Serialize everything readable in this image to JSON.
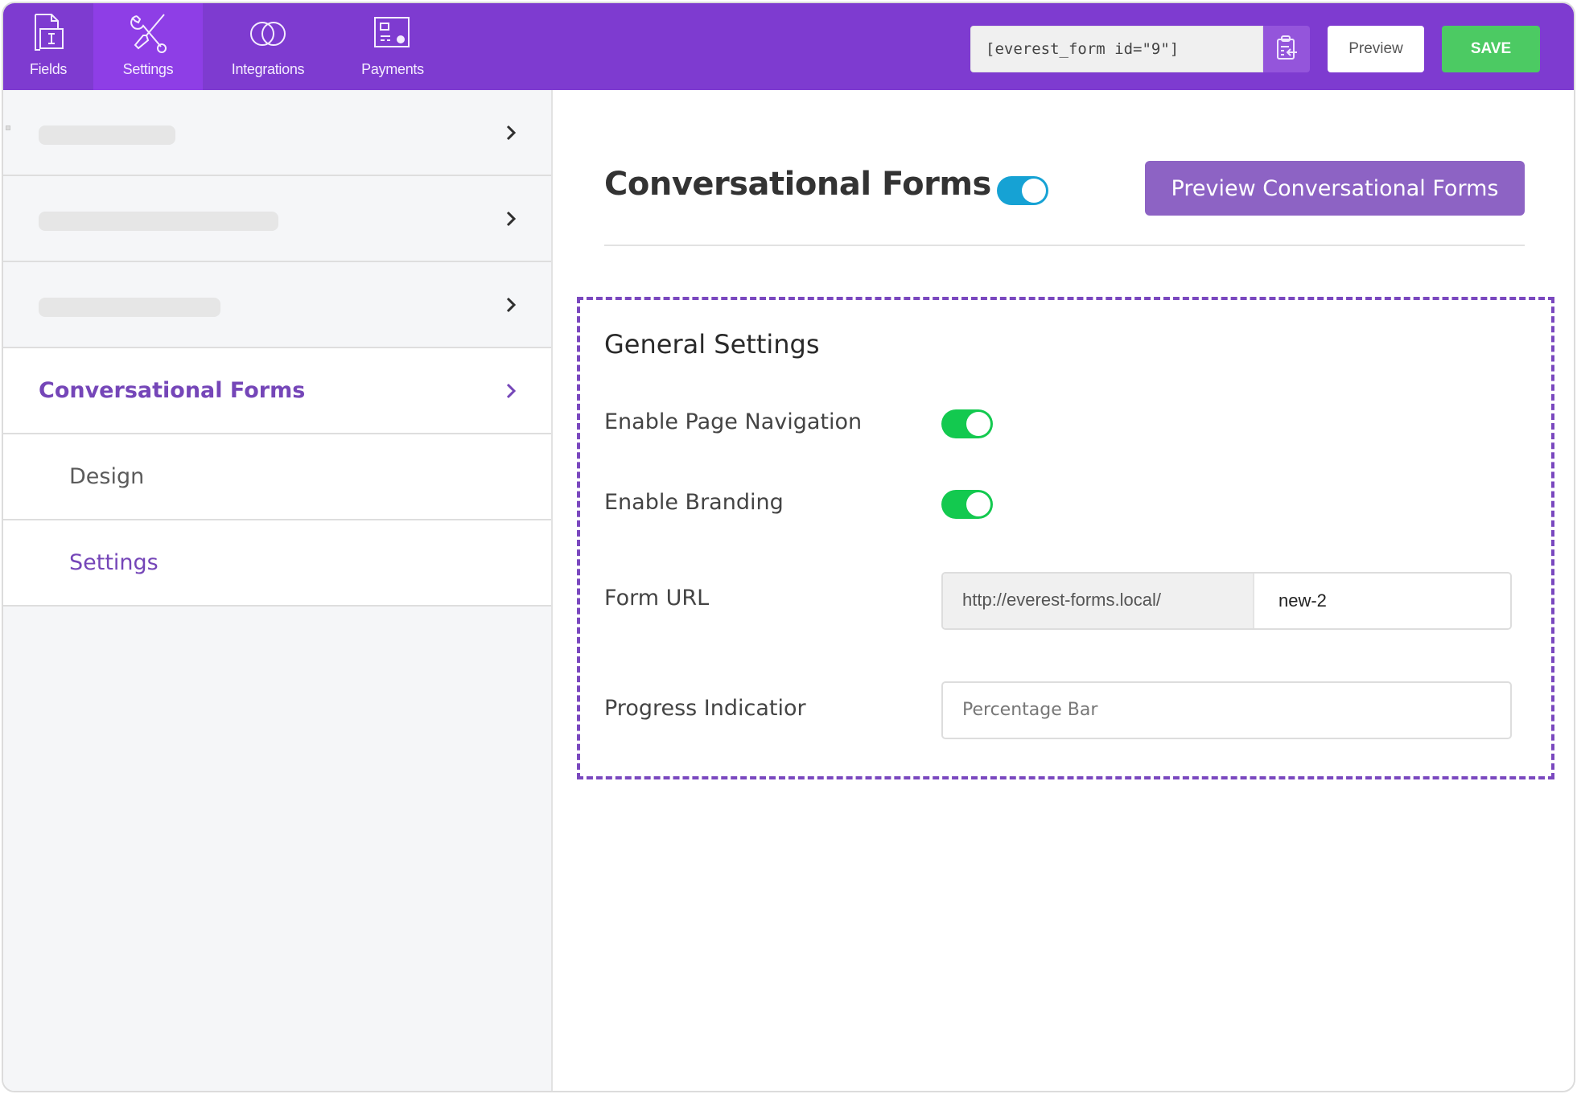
{
  "topbar": {
    "tabs": [
      {
        "label": "Fields",
        "icon": "fields-icon"
      },
      {
        "label": "Settings",
        "icon": "settings-tools-icon",
        "active": true
      },
      {
        "label": "Integrations",
        "icon": "integrations-icon"
      },
      {
        "label": "Payments",
        "icon": "payments-icon"
      }
    ],
    "shortcode": "[everest_form id=\"9\"]",
    "copy_icon": "clipboard-copy-icon",
    "preview_label": "Preview",
    "save_label": "SAVE"
  },
  "sidebar": {
    "items": [
      {
        "label": "",
        "placeholder": true
      },
      {
        "label": "",
        "placeholder": true
      },
      {
        "label": "",
        "placeholder": true
      },
      {
        "label": "Conversational Forms",
        "active": true
      },
      {
        "label": "Design",
        "sub": true
      },
      {
        "label": "Settings",
        "sub": true,
        "active": true
      }
    ]
  },
  "main": {
    "title": "Conversational Forms",
    "title_toggle_on": true,
    "preview_button": "Preview Conversational Forms",
    "general": {
      "title": "General Settings",
      "enable_page_navigation": {
        "label": "Enable Page Navigation",
        "on": true
      },
      "enable_branding": {
        "label": "Enable Branding",
        "on": true
      },
      "form_url": {
        "label": "Form URL",
        "prefix": "http://everest-forms.local/",
        "value": "new-2"
      },
      "progress_indicator": {
        "label": "Progress Indicatior",
        "value": "Percentage Bar"
      }
    }
  },
  "colors": {
    "brand_purple": "#7e3bd0",
    "active_tab": "#8e3ee6",
    "save_green": "#4cca63",
    "toggle_blue": "#16a2d4",
    "toggle_green": "#13c94f",
    "accent_text": "#7546b8"
  }
}
